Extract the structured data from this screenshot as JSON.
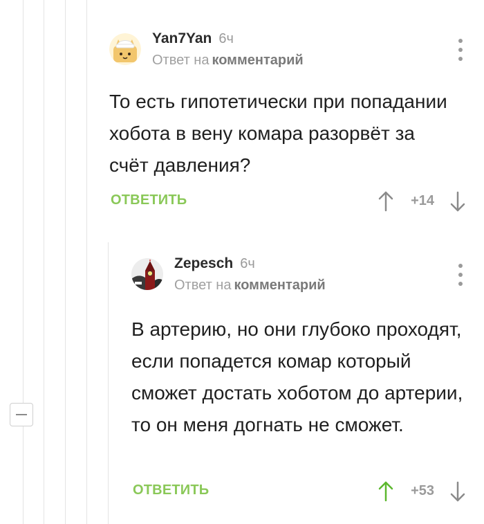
{
  "thread": {
    "collapse_icon": "minus-icon"
  },
  "comments": [
    {
      "author": "Yan7Yan",
      "time": "6ч",
      "reply_prefix": "Ответ на",
      "reply_link": "комментарий",
      "text": "То есть гипотетически при попадании хобота в вену комара разорвёт за счёт давления?",
      "reply_label": "ОТВЕТИТЬ",
      "rating": "+14",
      "upvoted": false,
      "avatar_icon": "cat-avatar-icon",
      "menu_icon": "more-vertical-icon"
    },
    {
      "author": "Zepesch",
      "time": "6ч",
      "reply_prefix": "Ответ на",
      "reply_link": "комментарий",
      "text": "В артерию, но они глубоко проходят, если попадется комар который сможет достать хоботом до артерии, то он меня догнать не сможет.",
      "reply_label": "ОТВЕТИТЬ",
      "rating": "+53",
      "upvoted": true,
      "avatar_icon": "kremlin-avatar-icon",
      "menu_icon": "more-vertical-icon"
    }
  ],
  "colors": {
    "accent_green": "#8ac858",
    "muted_gray": "#9a9a9a",
    "arrow_gray": "#8a8a8a"
  }
}
